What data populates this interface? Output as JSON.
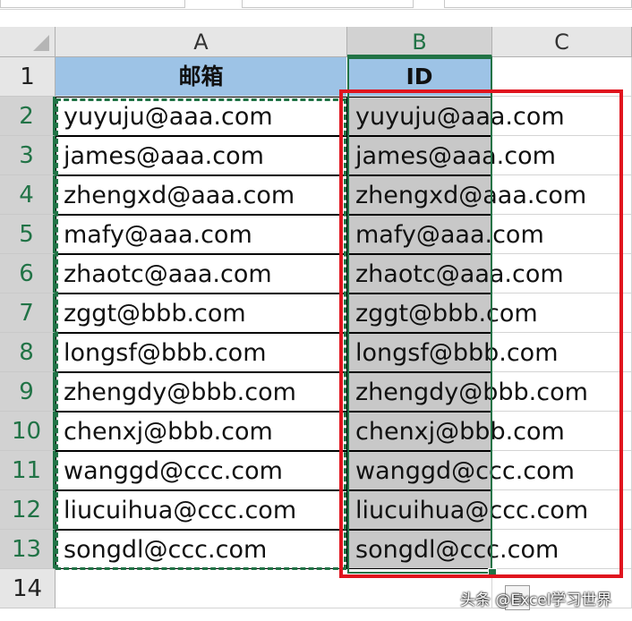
{
  "columns": [
    "A",
    "B",
    "C"
  ],
  "rows": [
    "1",
    "2",
    "3",
    "4",
    "5",
    "6",
    "7",
    "8",
    "9",
    "10",
    "11",
    "12",
    "13",
    "14"
  ],
  "headers": {
    "a": "邮箱",
    "b": "ID"
  },
  "col_a": [
    "yuyuju@aaa.com",
    "james@aaa.com",
    "zhengxd@aaa.com",
    "mafy@aaa.com",
    "zhaotc@aaa.com",
    "zggt@bbb.com",
    "longsf@bbb.com",
    "zhengdy@bbb.com",
    "chenxj@bbb.com",
    "wanggd@ccc.com",
    "liucuihua@ccc.com",
    "songdl@ccc.com"
  ],
  "col_b": [
    "yuyuju@aaa.com",
    "james@aaa.com",
    "zhengxd@aaa.com",
    "mafy@aaa.com",
    "zhaotc@aaa.com",
    "zggt@bbb.com",
    "longsf@bbb.com",
    "zhengdy@bbb.com",
    "chenxj@bbb.com",
    "wanggd@ccc.com",
    "liucuihua@ccc.com",
    "songdl@ccc.com"
  ],
  "watermark": "头条 @Excel学习世界",
  "paste_icon": "clipboard-icon",
  "colors": {
    "header_fill": "#9dc3e6",
    "selection": "#217346",
    "highlight_box": "#e0141e",
    "selected_fill": "#c8c8c8"
  }
}
